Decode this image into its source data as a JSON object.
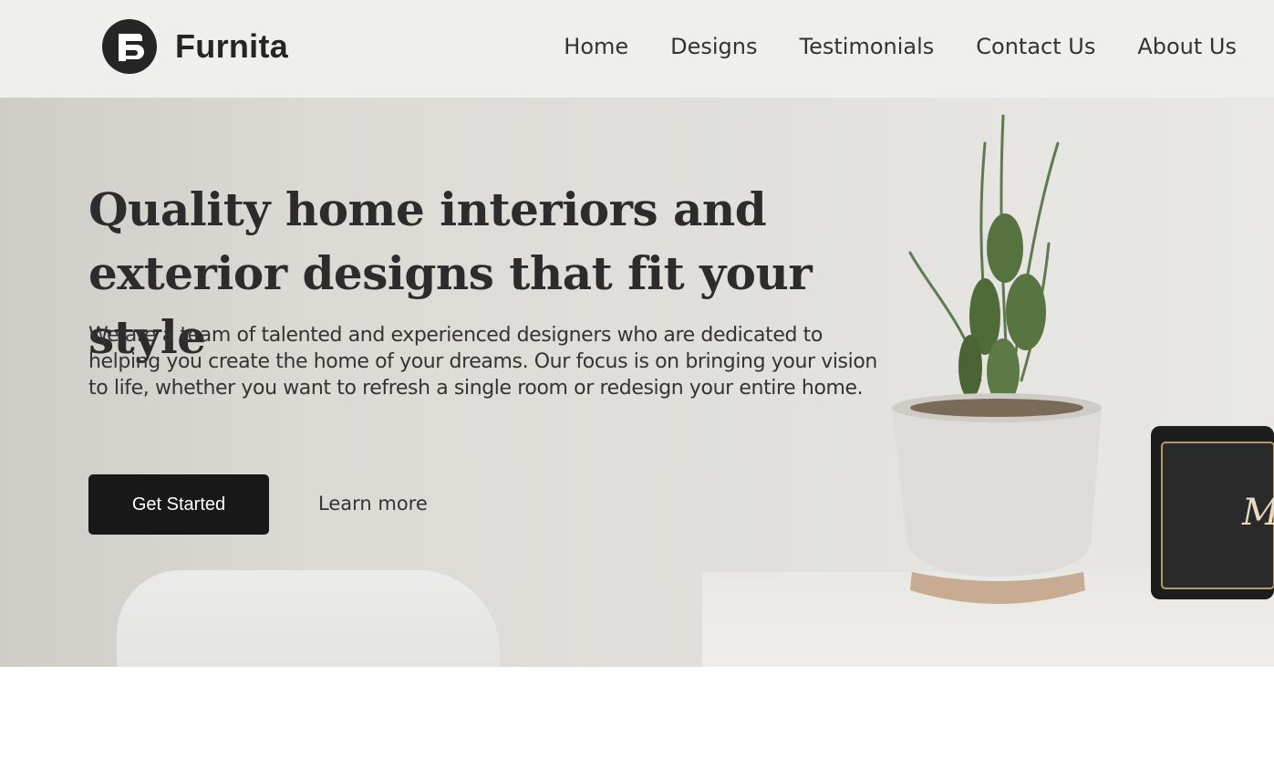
{
  "brand": {
    "name": "Furnita",
    "logo_icon": "furnita-logo-icon"
  },
  "nav": {
    "items": [
      {
        "label": "Home"
      },
      {
        "label": "Designs"
      },
      {
        "label": "Testimonials"
      },
      {
        "label": "Contact Us"
      },
      {
        "label": "About Us"
      }
    ]
  },
  "hero": {
    "title": "Quality home interiors and exterior designs that fit your style",
    "text": "We are a team of talented and experienced designers who are dedicated to helping you create the home of your dreams. Our focus is on bringing your vision to life, whether you want to refresh a single room or redesign your entire home.",
    "primary_button": "Get Started",
    "secondary_link": "Learn more",
    "speaker_brand_glyph": "M"
  },
  "colors": {
    "navbar_bg": "#efefed",
    "primary_button_bg": "#181818",
    "text": "#2c2c2c"
  }
}
